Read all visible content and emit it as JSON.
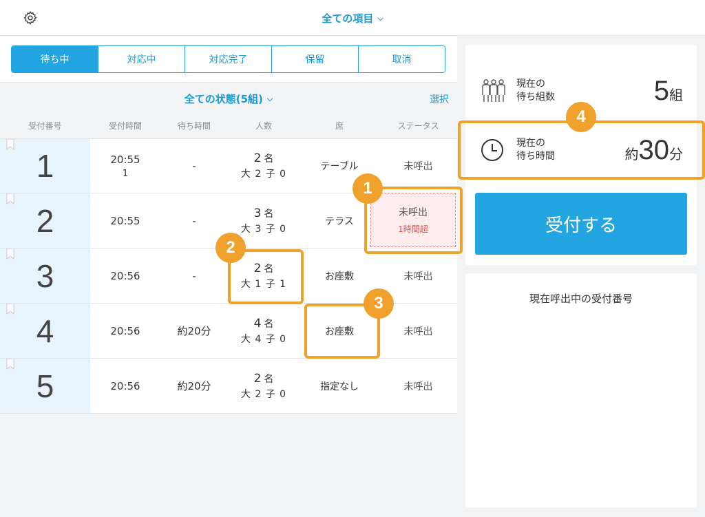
{
  "topbar": {
    "title": "全ての項目",
    "settings_icon": "gear-icon"
  },
  "tabs": [
    {
      "label": "待ち中",
      "active": true
    },
    {
      "label": "対応中",
      "active": false
    },
    {
      "label": "対応完了",
      "active": false
    },
    {
      "label": "保留",
      "active": false
    },
    {
      "label": "取消",
      "active": false
    }
  ],
  "filter": {
    "label": "全ての状態(5組)",
    "select": "選択"
  },
  "columns": [
    "受付番号",
    "受付時間",
    "待ち時間",
    "人数",
    "席",
    "ステータス"
  ],
  "rows": [
    {
      "num": "1",
      "time": "20:55",
      "time_sub": "1",
      "wait": "-",
      "people": "2",
      "people_unit": "名",
      "breakdown": "大 2 子 0",
      "seat": "テーブル",
      "status": "未呼出"
    },
    {
      "num": "2",
      "time": "20:55",
      "time_sub": "",
      "wait": "-",
      "people": "3",
      "people_unit": "名",
      "breakdown": "大 3 子 0",
      "seat": "テラス",
      "status": "未呼出",
      "overtime": "1時間超"
    },
    {
      "num": "3",
      "time": "20:56",
      "time_sub": "",
      "wait": "-",
      "people": "2",
      "people_unit": "名",
      "breakdown": "大 1 子 1",
      "seat": "お座敷",
      "status": "未呼出"
    },
    {
      "num": "4",
      "time": "20:56",
      "time_sub": "",
      "wait": "約20分",
      "people": "4",
      "people_unit": "名",
      "breakdown": "大 4 子 0",
      "seat": "お座敷",
      "status": "未呼出"
    },
    {
      "num": "5",
      "time": "20:56",
      "time_sub": "",
      "wait": "約20分",
      "people": "2",
      "people_unit": "名",
      "breakdown": "大 2 子 0",
      "seat": "指定なし",
      "status": "未呼出"
    }
  ],
  "stats": {
    "groups_label_1": "現在の",
    "groups_label_2": "待ち組数",
    "groups_value": "5",
    "groups_unit": "組",
    "time_label_1": "現在の",
    "time_label_2": "待ち時間",
    "time_prefix": "約",
    "time_value": "30",
    "time_unit": "分"
  },
  "accept_button": "受付する",
  "calling_title": "現在呼出中の受付番号",
  "badges": [
    "1",
    "2",
    "3",
    "4"
  ],
  "colors": {
    "accent": "#23a5e2",
    "callout": "#f0a12b",
    "overdue_bg": "#fdeced",
    "overdue_text": "#e34b4b"
  }
}
